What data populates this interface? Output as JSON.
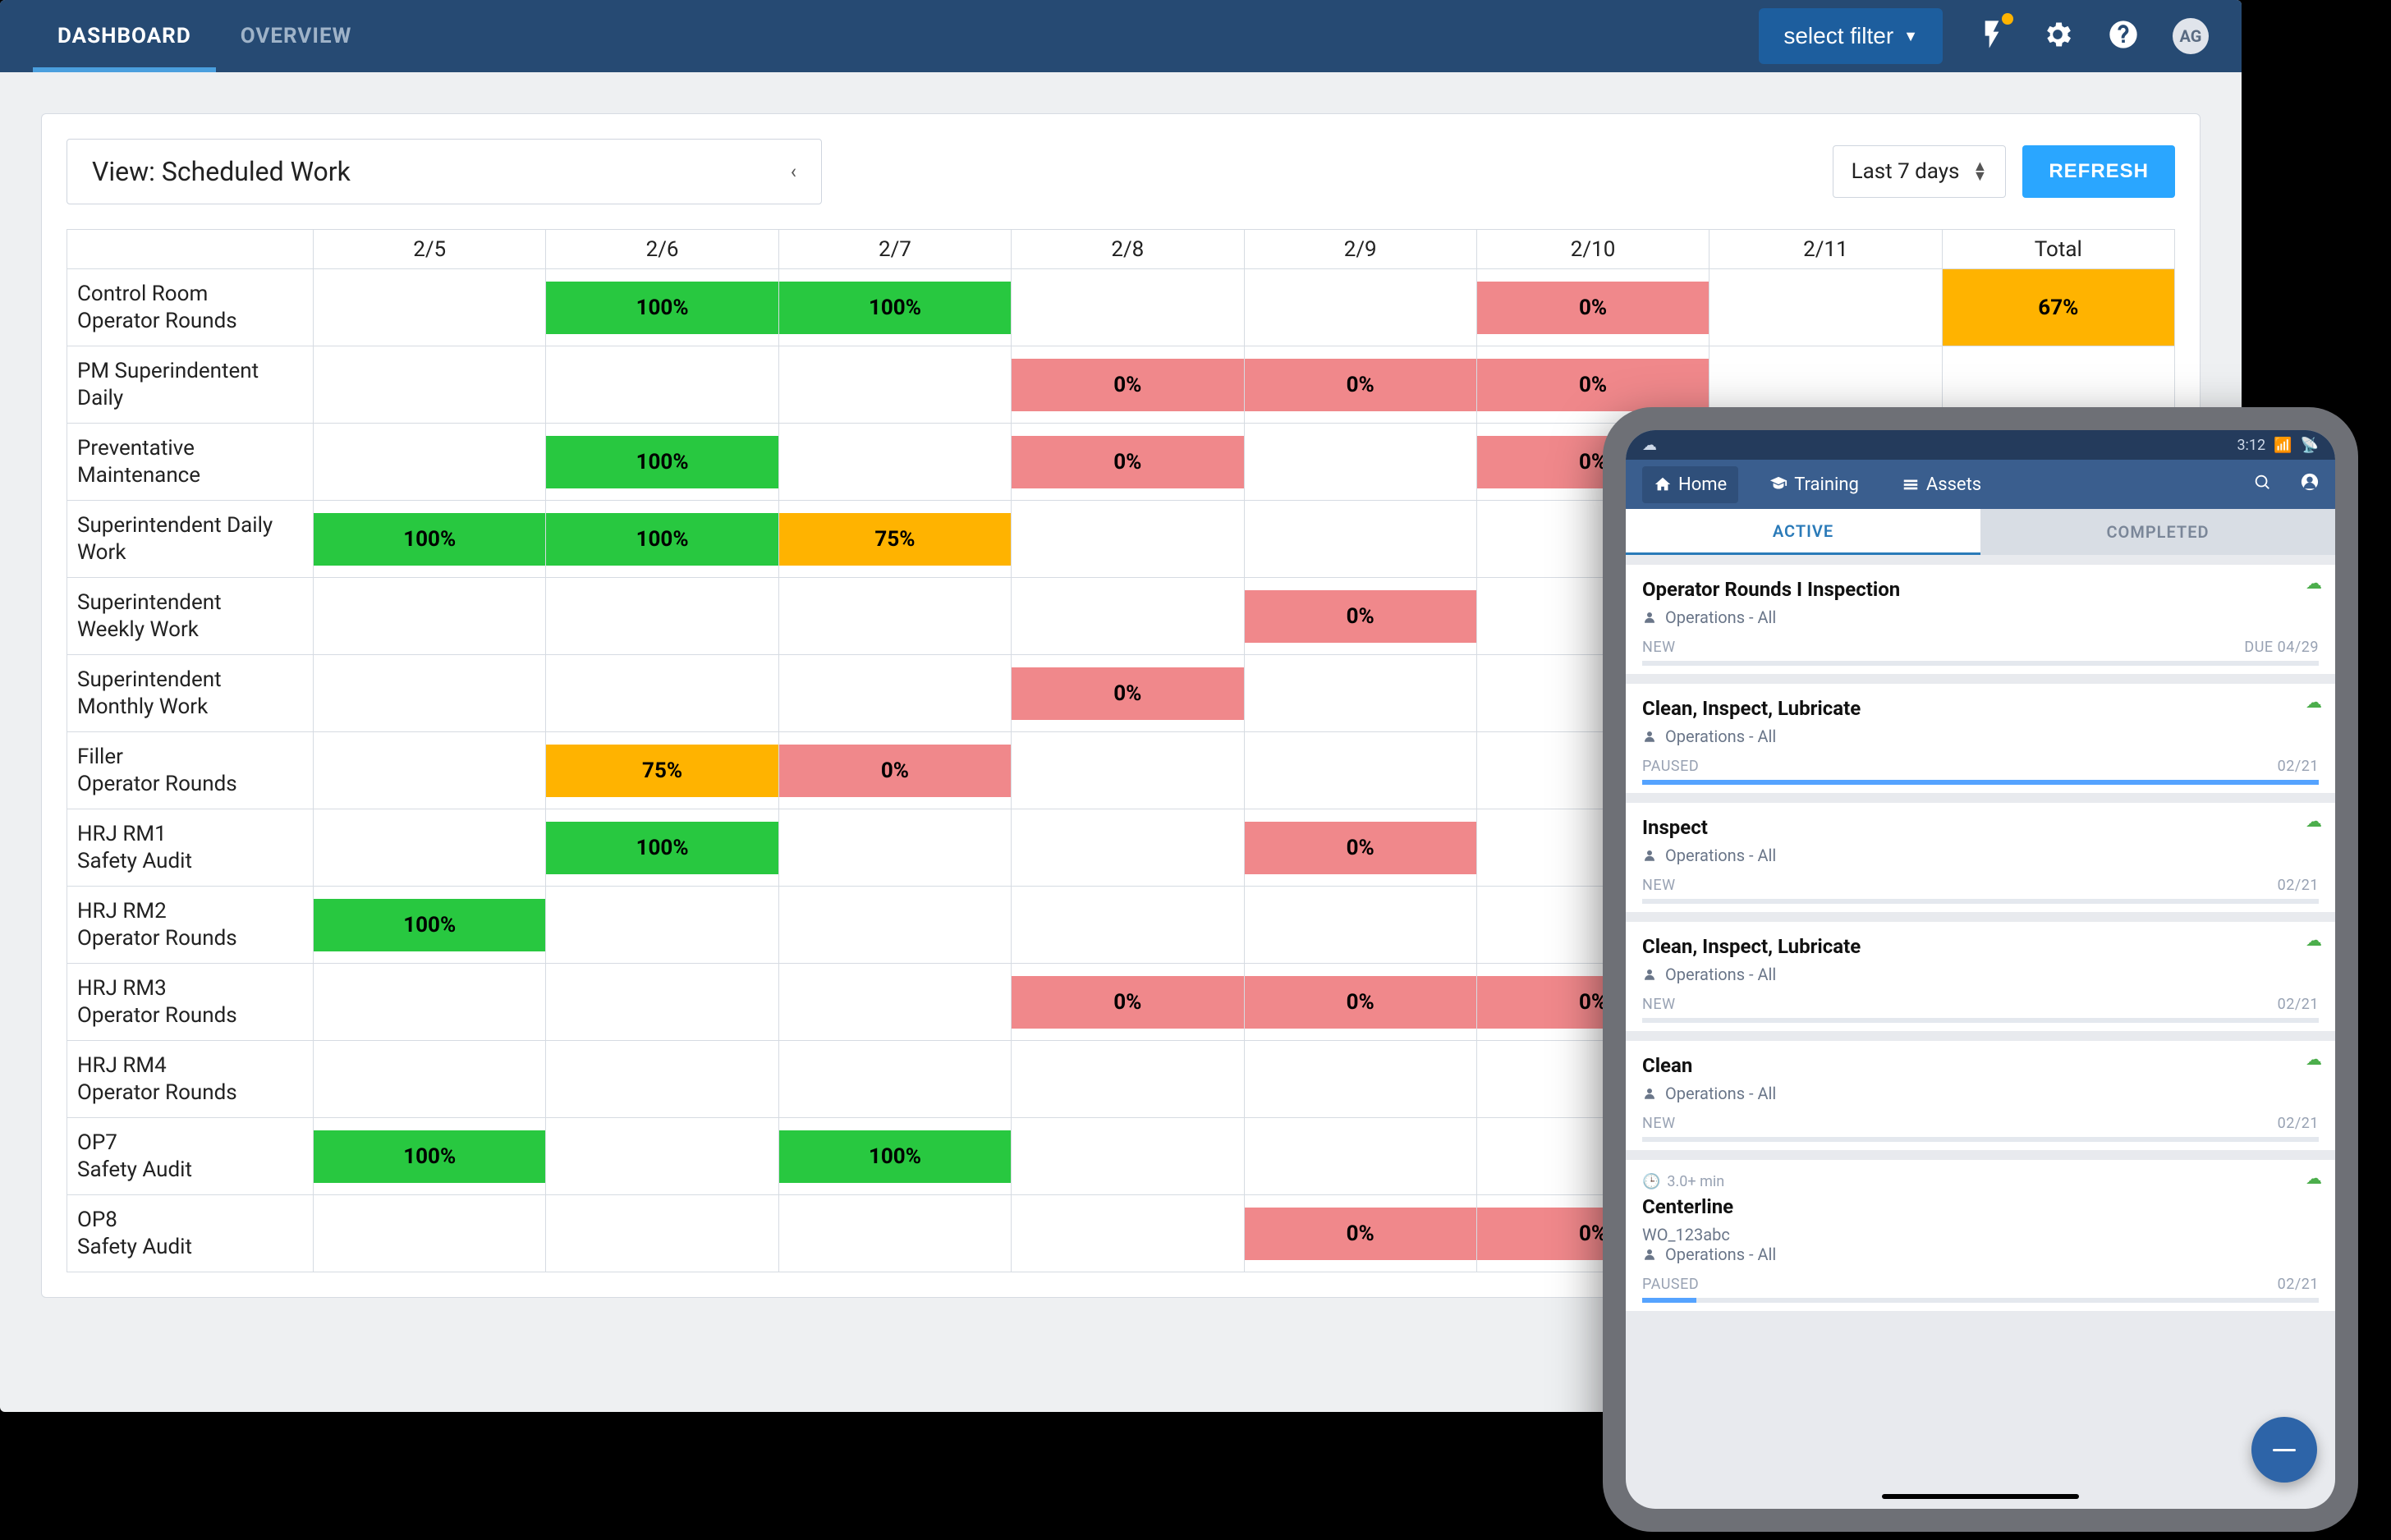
{
  "topbar": {
    "tabs": [
      "DASHBOARD",
      "OVERVIEW"
    ],
    "active_tab": 0,
    "filter_label": "select filter",
    "avatar_initials": "AG"
  },
  "panel": {
    "view_label": "View: Scheduled Work",
    "range_label": "Last 7 days",
    "refresh_label": "REFRESH"
  },
  "chart_data": {
    "type": "table",
    "columns": [
      "2/5",
      "2/6",
      "2/7",
      "2/8",
      "2/9",
      "2/10",
      "2/11",
      "Total"
    ],
    "rows": [
      {
        "name": "Control Room\nOperator Rounds",
        "cells": [
          null,
          {
            "v": "100%",
            "c": "green"
          },
          {
            "v": "100%",
            "c": "green"
          },
          null,
          null,
          {
            "v": "0%",
            "c": "red"
          },
          null,
          {
            "v": "67%",
            "c": "yellow",
            "full": true
          }
        ]
      },
      {
        "name": "PM Superindentent\nDaily",
        "cells": [
          null,
          null,
          null,
          {
            "v": "0%",
            "c": "red"
          },
          {
            "v": "0%",
            "c": "red"
          },
          {
            "v": "0%",
            "c": "red"
          },
          null,
          null
        ]
      },
      {
        "name": "Preventative\nMaintenance",
        "cells": [
          null,
          {
            "v": "100%",
            "c": "green"
          },
          null,
          {
            "v": "0%",
            "c": "red"
          },
          null,
          {
            "v": "0%",
            "c": "red"
          },
          null,
          null
        ]
      },
      {
        "name": "Superintendent Daily\nWork",
        "cells": [
          {
            "v": "100%",
            "c": "green"
          },
          {
            "v": "100%",
            "c": "green"
          },
          {
            "v": "75%",
            "c": "yellow"
          },
          null,
          null,
          null,
          null,
          null
        ]
      },
      {
        "name": "Superintendent\nWeekly Work",
        "cells": [
          null,
          null,
          null,
          null,
          {
            "v": "0%",
            "c": "red"
          },
          null,
          null,
          null
        ]
      },
      {
        "name": "Superintendent\nMonthly Work",
        "cells": [
          null,
          null,
          null,
          {
            "v": "0%",
            "c": "red"
          },
          null,
          null,
          null,
          null
        ]
      },
      {
        "name": "Filler\nOperator Rounds",
        "cells": [
          null,
          {
            "v": "75%",
            "c": "yellow"
          },
          {
            "v": "0%",
            "c": "red"
          },
          null,
          null,
          null,
          null,
          null
        ]
      },
      {
        "name": "HRJ RM1\nSafety Audit",
        "cells": [
          null,
          {
            "v": "100%",
            "c": "green"
          },
          null,
          null,
          {
            "v": "0%",
            "c": "red"
          },
          null,
          null,
          null
        ]
      },
      {
        "name": "HRJ RM2\nOperator Rounds",
        "cells": [
          {
            "v": "100%",
            "c": "green"
          },
          null,
          null,
          null,
          null,
          null,
          null,
          null
        ]
      },
      {
        "name": "HRJ RM3\nOperator Rounds",
        "cells": [
          null,
          null,
          null,
          {
            "v": "0%",
            "c": "red"
          },
          {
            "v": "0%",
            "c": "red"
          },
          {
            "v": "0%",
            "c": "red"
          },
          null,
          null
        ]
      },
      {
        "name": "HRJ RM4\nOperator Rounds",
        "cells": [
          null,
          null,
          null,
          null,
          null,
          null,
          null,
          null
        ]
      },
      {
        "name": "OP7\nSafety Audit",
        "cells": [
          {
            "v": "100%",
            "c": "green"
          },
          null,
          {
            "v": "100%",
            "c": "green"
          },
          null,
          null,
          null,
          null,
          null
        ]
      },
      {
        "name": "OP8\nSafety Audit",
        "cells": [
          null,
          null,
          null,
          null,
          {
            "v": "0%",
            "c": "red"
          },
          {
            "v": "0%",
            "c": "red"
          },
          null,
          null
        ]
      }
    ]
  },
  "tablet": {
    "status_time": "3:12",
    "nav": {
      "home": "Home",
      "training": "Training",
      "assets": "Assets"
    },
    "tabs": {
      "active": "ACTIVE",
      "completed": "COMPLETED"
    },
    "cards": [
      {
        "title": "Operator Rounds I Inspection",
        "org": "Operations - All",
        "status": "NEW",
        "due": "DUE 04/29",
        "progress": 0
      },
      {
        "title": "Clean, Inspect, Lubricate",
        "org": "Operations - All",
        "status": "PAUSED",
        "due": "02/21",
        "progress": 100
      },
      {
        "title": "Inspect",
        "org": "Operations - All",
        "status": "NEW",
        "due": "02/21",
        "progress": 0
      },
      {
        "title": "Clean, Inspect, Lubricate",
        "org": "Operations - All",
        "status": "NEW",
        "due": "02/21",
        "progress": 0
      },
      {
        "title": "Clean",
        "org": "Operations - All",
        "status": "NEW",
        "due": "02/21",
        "progress": 0
      },
      {
        "title": "Centerline",
        "org": "Operations - All",
        "code": "WO_123abc",
        "mini": "3.0+ min",
        "status": "PAUSED",
        "due": "02/21",
        "progress": 8
      }
    ]
  }
}
